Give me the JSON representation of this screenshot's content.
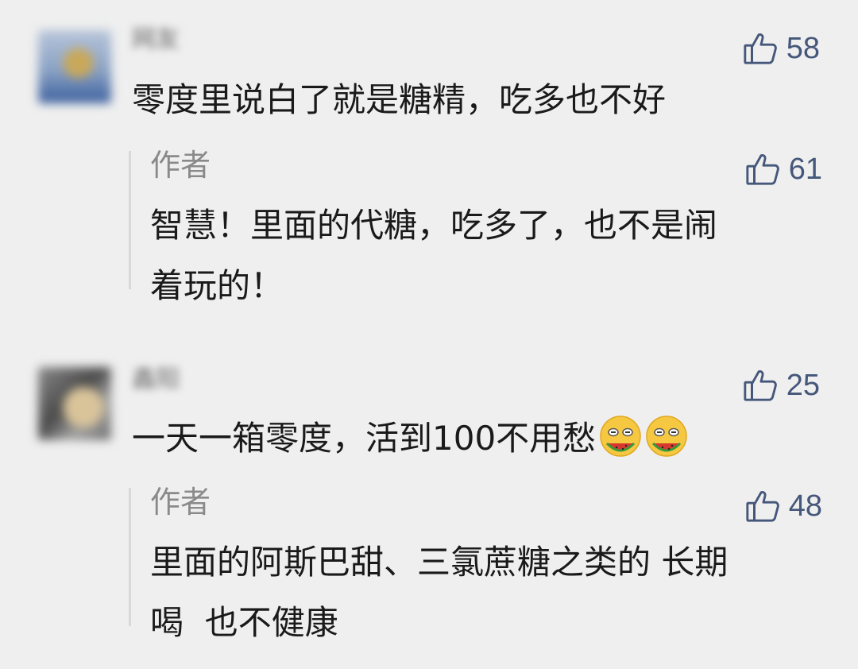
{
  "comments": [
    {
      "username": "网友",
      "likes": "58",
      "text": "零度里说白了就是糖精，吃多也不好",
      "reply": {
        "author": "作者",
        "likes": "61",
        "lines": [
          "智慧！里面的代糖，吃多了，也不是闹",
          "着玩的！"
        ]
      }
    },
    {
      "username": "鑫阳",
      "likes": "25",
      "text": "一天一箱零度，活到100不用愁",
      "emoji": "watermelon-eating-emoji",
      "reply": {
        "author": "作者",
        "likes": "48",
        "lines": [
          "里面的阿斯巴甜、三氯蔗糖之类的 长期",
          "喝  也不健康"
        ]
      }
    }
  ],
  "colors": {
    "background": "#efefef",
    "like_blue": "#45577a",
    "reply_author_gray": "#8a8a8a",
    "reply_bar": "#d8d8d8"
  },
  "icons": {
    "like": "thumbs-up-icon",
    "avatar": "blurred-avatar"
  }
}
